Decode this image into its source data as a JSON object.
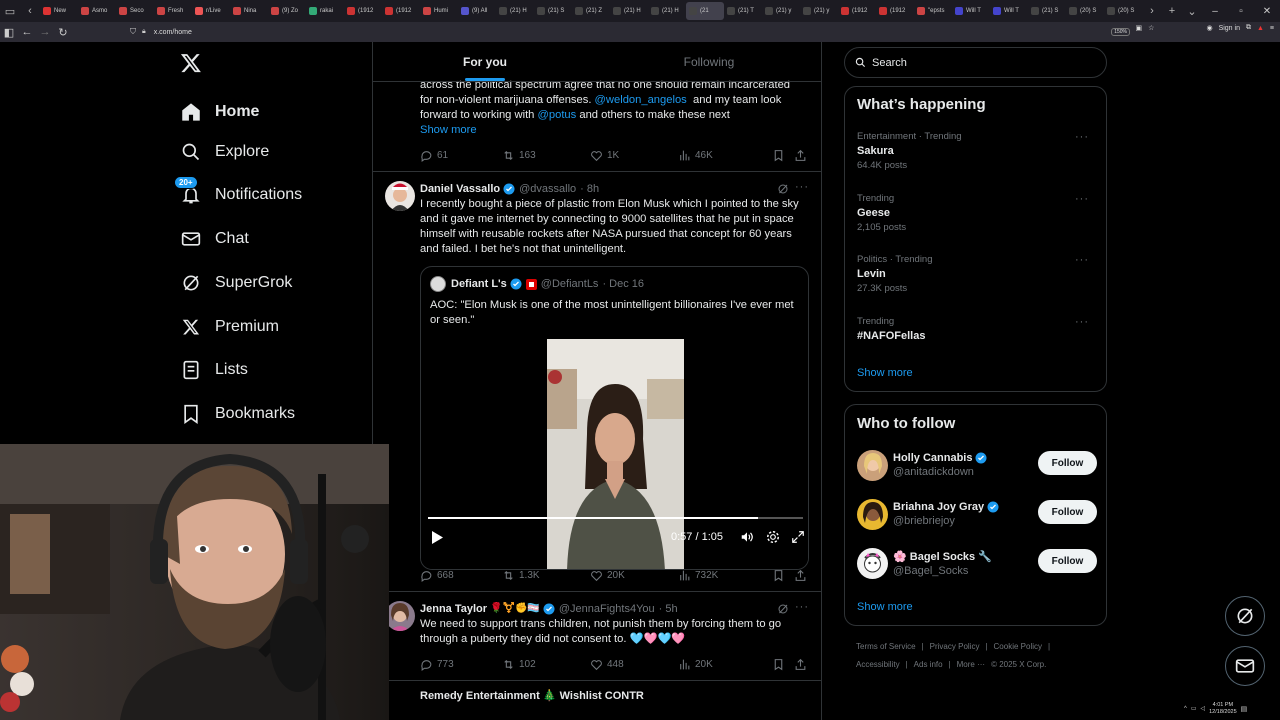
{
  "browser": {
    "tabs": [
      {
        "label": "New",
        "color": "#d33"
      },
      {
        "label": "Asmo",
        "color": "#c44"
      },
      {
        "label": "Seco",
        "color": "#c44"
      },
      {
        "label": "Fresh",
        "color": "#c44"
      },
      {
        "label": "r/Live",
        "color": "#e55"
      },
      {
        "label": "Nina",
        "color": "#c44"
      },
      {
        "label": "(9) Zo",
        "color": "#c44"
      },
      {
        "label": "rakai",
        "color": "#3a7"
      },
      {
        "label": "(1912",
        "color": "#c33"
      },
      {
        "label": "(1912",
        "color": "#c33"
      },
      {
        "label": "Humi",
        "color": "#c44"
      },
      {
        "label": "(9) All",
        "color": "#55c"
      },
      {
        "label": "(21) H",
        "color": "#444"
      },
      {
        "label": "(21) S",
        "color": "#444"
      },
      {
        "label": "(21) Z",
        "color": "#444"
      },
      {
        "label": "(21) H",
        "color": "#444"
      },
      {
        "label": "(21) H",
        "color": "#444"
      },
      {
        "label": "(21",
        "color": "#444",
        "active": true
      },
      {
        "label": "(21) T",
        "color": "#444"
      },
      {
        "label": "(21) y",
        "color": "#444"
      },
      {
        "label": "(21) y",
        "color": "#444"
      },
      {
        "label": "(1912",
        "color": "#c33"
      },
      {
        "label": "(1912",
        "color": "#c33"
      },
      {
        "label": "\"epsts",
        "color": "#c44"
      },
      {
        "label": "Will T",
        "color": "#44c"
      },
      {
        "label": "Will T",
        "color": "#44c"
      },
      {
        "label": "(21) S",
        "color": "#444"
      },
      {
        "label": "(20) S",
        "color": "#444"
      },
      {
        "label": "(20) S",
        "color": "#444"
      }
    ],
    "url": "x.com/home",
    "zoom": "150%",
    "sign_in": "Sign in"
  },
  "nav": {
    "items": [
      {
        "label": "Home",
        "icon": "home-icon"
      },
      {
        "label": "Explore",
        "icon": "search-icon"
      },
      {
        "label": "Notifications",
        "icon": "bell-icon",
        "badge": "20+"
      },
      {
        "label": "Chat",
        "icon": "mail-icon"
      },
      {
        "label": "SuperGrok",
        "icon": "grok-icon"
      },
      {
        "label": "Premium",
        "icon": "x-icon"
      },
      {
        "label": "Lists",
        "icon": "list-icon"
      },
      {
        "label": "Bookmarks",
        "icon": "bookmark-icon"
      }
    ]
  },
  "feed": {
    "tabs": [
      "For you",
      "Following"
    ],
    "prev_post": {
      "line1": "across the political spectrum agree that no one should remain incarcerated",
      "line2_pre": "for non-violent marijuana offenses. ",
      "mention1": "@weldon_angelos",
      "line2_post": "  and my team look",
      "line3_pre": "forward to working with ",
      "mention2": "@potus",
      "line3_post": " and others to make these next",
      "show_more": "Show more",
      "replies": "61",
      "reposts": "163",
      "likes": "1K",
      "views": "46K"
    },
    "post1": {
      "name": "Daniel Vassallo",
      "handle": "@dvassallo",
      "time": "· 8h",
      "text": "I recently bought a piece of plastic from Elon Musk which I pointed to the sky and it gave me internet by connecting to 9000 satellites that he put in space himself with reusable rockets after NASA pursued that concept for 60 years and failed. I bet he's not that unintelligent.",
      "quote": {
        "name": "Defiant L's",
        "handle": "@DefiantLs",
        "time": "· Dec 16",
        "text": "AOC: \"Elon Musk is one of the most unintelligent billionaires I've ever met or seen.\"",
        "video_time": "0:57 / 1:05",
        "progress": 0.88
      },
      "replies": "668",
      "reposts": "1.3K",
      "likes": "20K",
      "views": "732K"
    },
    "post2": {
      "name": "Jenna Taylor",
      "emoji": "🌹⚧️✊🏳️‍⚧️",
      "handle": "@JennaFights4You",
      "time": "· 5h",
      "text": "We need to support trans children, not punish them by forcing them to go through a puberty they did not consent to. 🩵🩷🩵🩷",
      "replies": "773",
      "reposts": "102",
      "likes": "448",
      "views": "20K"
    },
    "post3_partial": "Remedy Entertainment 🎄 Wishlist CONTR"
  },
  "right": {
    "search_placeholder": "Search",
    "happening_title": "What’s happening",
    "trends": [
      {
        "category": "Entertainment · Trending",
        "topic": "Sakura",
        "count": "64.4K posts"
      },
      {
        "category": "Trending",
        "topic": "Geese",
        "count": "2,105 posts"
      },
      {
        "category": "Politics · Trending",
        "topic": "Levin",
        "count": "27.3K posts"
      },
      {
        "category": "Trending",
        "topic": "#NAFOFellas",
        "count": ""
      }
    ],
    "show_more": "Show more",
    "who_title": "Who to follow",
    "follow": [
      {
        "name": "Holly Cannabis",
        "handle": "@anitadickdown",
        "button": "Follow"
      },
      {
        "name": "Briahna Joy Gray",
        "handle": "@briebriejoy",
        "button": "Follow"
      },
      {
        "name": "🌸 Bagel Socks 🔧",
        "handle": "@Bagel_Socks",
        "button": "Follow"
      }
    ],
    "footer": [
      "Terms of Service",
      "|",
      "Privacy Policy",
      "|",
      "Cookie Policy",
      "|",
      "Accessibility",
      "|",
      "Ads info",
      "|",
      "More ···",
      "© 2025 X Corp."
    ]
  },
  "taskbar": {
    "time": "4:01 PM",
    "date": "12/18/2025"
  },
  "colors": {
    "accent": "#1d9bf0",
    "border": "#2f3336",
    "muted": "#71767b",
    "text": "#e7e9ea"
  }
}
